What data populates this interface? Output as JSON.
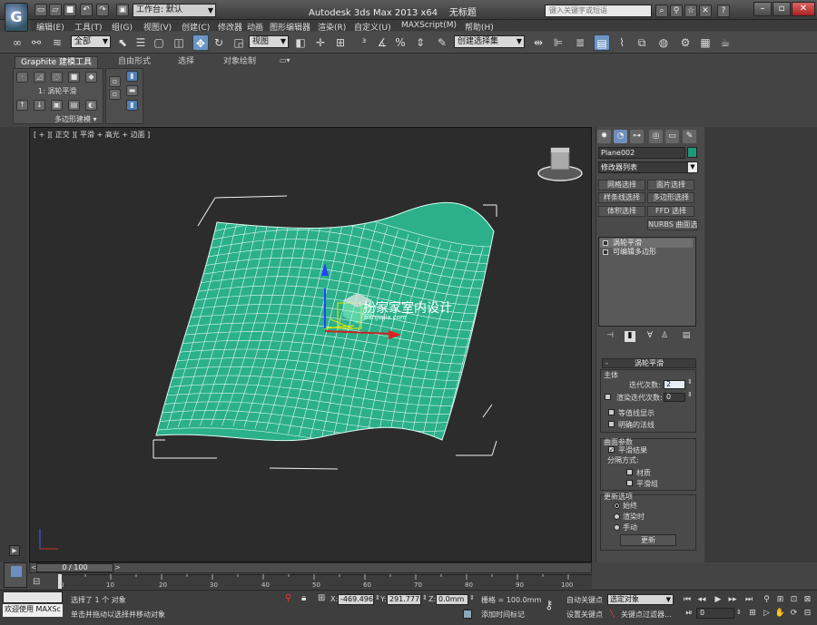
{
  "titlebar": {
    "app_logo": "G",
    "workspace": "工作台: 默认",
    "title": "Autodesk 3ds Max  2013 x64",
    "filename": "无标题",
    "search_placeholder": "键入关键字或短语"
  },
  "menubar": [
    "编辑(E)",
    "工具(T)",
    "组(G)",
    "视图(V)",
    "创建(C)",
    "修改器",
    "动画",
    "图形编辑器",
    "渲染(R)",
    "自定义(U)",
    "MAXScript(M)",
    "帮助(H)"
  ],
  "toolbar": {
    "selection_filter": "全部",
    "ref_coord": "视图",
    "named_selection": "创建选择集"
  },
  "ribbon": {
    "tabs": [
      "Graphite 建模工具",
      "自由形式",
      "选择",
      "对象绘制"
    ],
    "modifier_label": "1: 涡轮平滑",
    "panel_label": "多边形建模"
  },
  "viewport": {
    "label": "[ + ][ 正交 ][ 平滑 + 高光 + 边面 ]",
    "watermark_title": "扮家家室内设计",
    "watermark_url": "banjiajia.com"
  },
  "command_panel": {
    "object_name": "Plane002",
    "object_color": "#1b9a75",
    "modifier_list": "修改器列表",
    "modifier_buttons": [
      "网格选择",
      "面片选择",
      "样条线选择",
      "多边形选择",
      "体积选择",
      "FFD 选择",
      "NURBS 曲面选择"
    ],
    "stack": [
      "涡轮平滑",
      "可编辑多边形"
    ]
  },
  "turbosmooth": {
    "title": "涡轮平滑",
    "main_group": "主体",
    "iterations_label": "迭代次数:",
    "iterations_value": "2",
    "render_iters_label": "渲染迭代次数:",
    "render_iters_value": "0",
    "isoline_label": "等值线显示",
    "explicit_normals_label": "明确的法线",
    "surface_group": "曲面参数",
    "smooth_result_label": "平滑结果",
    "sep_label": "分隔方式:",
    "materials_label": "材质",
    "smoothing_groups_label": "平滑组",
    "update_group": "更新选项",
    "update_options": [
      "始终",
      "渲染时",
      "手动"
    ],
    "update_button": "更新"
  },
  "timeline": {
    "position": "0 / 100",
    "ticks": [
      "0",
      "10",
      "20",
      "30",
      "40",
      "50",
      "60",
      "70",
      "80",
      "90",
      "100"
    ]
  },
  "status": {
    "listener": "欢迎使用 MAXSc",
    "selected_text": "选择了 1 个 对象",
    "prompt_text": "单击并拖动以选择并移动对象",
    "x_label": "X:",
    "x_value": "-469.496m",
    "y_label": "Y:",
    "y_value": "291.777mr",
    "z_label": "Z:",
    "z_value": "0.0mm",
    "grid_text": "栅格 = 100.0mm",
    "add_time_tag": "添加时间标记",
    "auto_key": "自动关键点",
    "set_key": "设置关键点",
    "key_mode": "选定对象",
    "key_filters": "关键点过滤器...",
    "frame": "0"
  }
}
